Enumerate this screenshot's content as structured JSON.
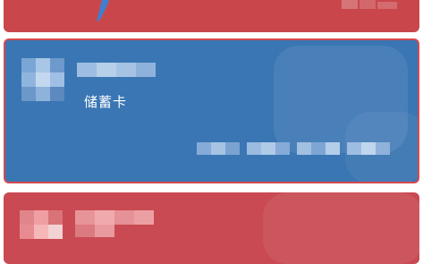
{
  "cards": [
    {
      "color": "#c9474b"
    },
    {
      "color": "#3a76b3",
      "card_type": "储蓄卡"
    },
    {
      "color": "#c94a52"
    }
  ]
}
